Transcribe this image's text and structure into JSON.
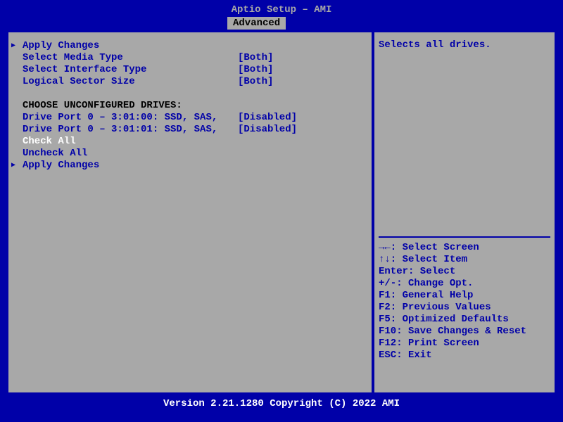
{
  "header": {
    "title": "Aptio Setup – AMI",
    "tab": "Advanced"
  },
  "menu": {
    "apply_top": "Apply Changes",
    "media_type": {
      "label": "Select Media Type",
      "value": "[Both]"
    },
    "interface_type": {
      "label": "Select Interface Type",
      "value": "[Both]"
    },
    "sector_size": {
      "label": "Logical Sector Size",
      "value": "[Both]"
    },
    "choose_header": "CHOOSE UNCONFIGURED DRIVES:",
    "drive0": {
      "label": "Drive Port 0 – 3:01:00: SSD, SAS,",
      "value": "[Disabled]"
    },
    "drive1": {
      "label": "Drive Port 0 – 3:01:01: SSD, SAS,",
      "value": "[Disabled]"
    },
    "check_all": "Check All",
    "uncheck_all": "Uncheck All",
    "apply_bottom": "Apply Changes"
  },
  "help": {
    "description": "Selects all drives.",
    "keys": {
      "select_screen": "→←: Select Screen",
      "select_item": "↑↓: Select Item",
      "enter": "Enter: Select",
      "change": "+/-: Change Opt.",
      "f1": "F1: General Help",
      "f2": "F2: Previous Values",
      "f5": "F5: Optimized Defaults",
      "f10": "F10: Save Changes & Reset",
      "f12": "F12: Print Screen",
      "esc": "ESC: Exit"
    }
  },
  "footer": "Version 2.21.1280 Copyright (C) 2022 AMI"
}
